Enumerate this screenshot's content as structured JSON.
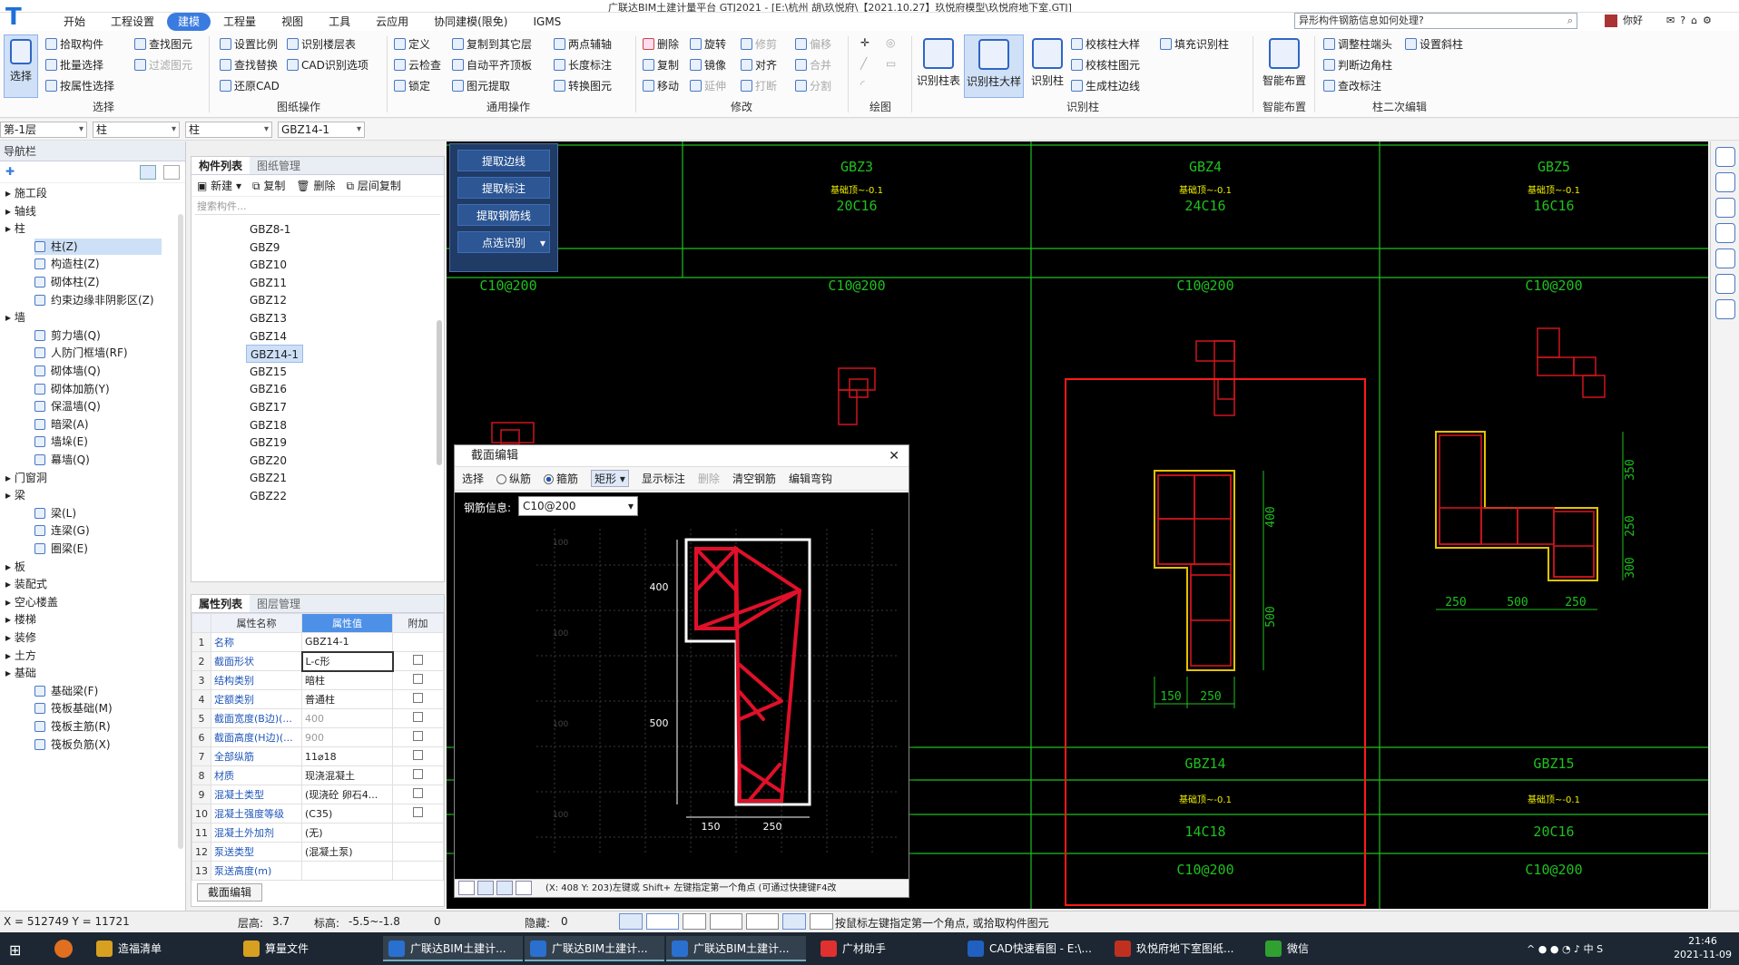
{
  "window": {
    "title": "广联达BIM土建计量平台 GTJ2021 - [E:\\杭州 胡\\玖悦府\\【2021.10.27】玖悦府模型\\玖悦府地下室.GTJ]"
  },
  "menu": {
    "items": [
      "开始",
      "工程设置",
      "建模",
      "工程量",
      "视图",
      "工具",
      "云应用",
      "协同建模(限免)",
      "IGMS"
    ],
    "active": "建模"
  },
  "search": {
    "value": "异形构件钢筋信息如何处理?"
  },
  "user": {
    "greeting": "你好"
  },
  "ribbon": {
    "select": {
      "label": "选择",
      "big": "选择",
      "items": [
        "拾取构件",
        "批量选择",
        "按属性选择"
      ]
    },
    "drawing": {
      "label": "图纸操作",
      "items": [
        "查找图元",
        "过滤图元",
        "设置比例",
        "查找替换",
        "还原CAD",
        "识别楼层表",
        "CAD识别选项"
      ]
    },
    "common": {
      "label": "通用操作",
      "items": [
        "定义",
        "云检查",
        "锁定",
        "复制到其它层",
        "自动平齐顶板",
        "图元提取",
        "两点辅轴",
        "长度标注",
        "转换图元"
      ]
    },
    "modify": {
      "label": "修改",
      "items": [
        "删除",
        "复制",
        "移动",
        "旋转",
        "镜像",
        "延伸",
        "修剪",
        "对齐",
        "打断",
        "偏移",
        "合并",
        "分割"
      ]
    },
    "draw": {
      "label": "绘图"
    },
    "recog": {
      "label": "识别柱",
      "items": [
        "识别柱表",
        "识别柱大样",
        "识别柱",
        "校核柱大样",
        "校核柱图元",
        "生成柱边线",
        "填充识别柱"
      ]
    },
    "smart": {
      "label": "智能布置",
      "big": "智能布置"
    },
    "edit2": {
      "label": "柱二次编辑",
      "items": [
        "调整柱端头",
        "设置斜柱",
        "判断边角柱",
        "查改标注"
      ]
    }
  },
  "selectors": {
    "floor": "第-1层",
    "type": "柱",
    "subtype": "柱",
    "component": "GBZ14-1"
  },
  "nav": {
    "title": "导航栏",
    "tree": [
      {
        "label": "施工段",
        "level": 0
      },
      {
        "label": "轴线",
        "level": 0
      },
      {
        "label": "柱",
        "level": 0
      },
      {
        "label": "柱(Z)",
        "level": 1,
        "selected": true
      },
      {
        "label": "构造柱(Z)",
        "level": 1
      },
      {
        "label": "砌体柱(Z)",
        "level": 1
      },
      {
        "label": "约束边缘非阴影区(Z)",
        "level": 1
      },
      {
        "label": "墙",
        "level": 0
      },
      {
        "label": "剪力墙(Q)",
        "level": 1
      },
      {
        "label": "人防门框墙(RF)",
        "level": 1
      },
      {
        "label": "砌体墙(Q)",
        "level": 1
      },
      {
        "label": "砌体加筋(Y)",
        "level": 1
      },
      {
        "label": "保温墙(Q)",
        "level": 1
      },
      {
        "label": "暗梁(A)",
        "level": 1
      },
      {
        "label": "墙垛(E)",
        "level": 1
      },
      {
        "label": "幕墙(Q)",
        "level": 1
      },
      {
        "label": "门窗洞",
        "level": 0
      },
      {
        "label": "梁",
        "level": 0
      },
      {
        "label": "梁(L)",
        "level": 1
      },
      {
        "label": "连梁(G)",
        "level": 1
      },
      {
        "label": "圈梁(E)",
        "level": 1
      },
      {
        "label": "板",
        "level": 0
      },
      {
        "label": "装配式",
        "level": 0
      },
      {
        "label": "空心楼盖",
        "level": 0
      },
      {
        "label": "楼梯",
        "level": 0
      },
      {
        "label": "装修",
        "level": 0
      },
      {
        "label": "土方",
        "level": 0
      },
      {
        "label": "基础",
        "level": 0
      },
      {
        "label": "基础梁(F)",
        "level": 1
      },
      {
        "label": "筏板基础(M)",
        "level": 1
      },
      {
        "label": "筏板主筋(R)",
        "level": 1
      },
      {
        "label": "筏板负筋(X)",
        "level": 1
      }
    ]
  },
  "complist": {
    "tabs": [
      "构件列表",
      "图纸管理"
    ],
    "tools": [
      "新建",
      "复制",
      "删除",
      "层间复制"
    ],
    "search_placeholder": "搜索构件...",
    "items": [
      "GBZ8-1",
      "GBZ9",
      "GBZ10",
      "GBZ11",
      "GBZ12",
      "GBZ13",
      "GBZ14",
      "GBZ14-1",
      "GBZ15",
      "GBZ16",
      "GBZ17",
      "GBZ18",
      "GBZ19",
      "GBZ20",
      "GBZ21",
      "GBZ22"
    ],
    "selected": "GBZ14-1"
  },
  "props": {
    "tabs": [
      "属性列表",
      "图层管理"
    ],
    "headers": [
      "属性名称",
      "属性值",
      "附加"
    ],
    "rows": [
      {
        "n": "1",
        "k": "名称",
        "v": "GBZ14-1"
      },
      {
        "n": "2",
        "k": "截面形状",
        "v": "L-c形"
      },
      {
        "n": "3",
        "k": "结构类别",
        "v": "暗柱"
      },
      {
        "n": "4",
        "k": "定额类别",
        "v": "普通柱"
      },
      {
        "n": "5",
        "k": "截面宽度(B边)(...",
        "v": "400"
      },
      {
        "n": "6",
        "k": "截面高度(H边)(...",
        "v": "900"
      },
      {
        "n": "7",
        "k": "全部纵筋",
        "v": "11⌀18"
      },
      {
        "n": "8",
        "k": "材质",
        "v": "现浇混凝土"
      },
      {
        "n": "9",
        "k": "混凝土类型",
        "v": "(现浇砼 卵石4..."
      },
      {
        "n": "10",
        "k": "混凝土强度等级",
        "v": "(C35)"
      },
      {
        "n": "11",
        "k": "混凝土外加剂",
        "v": "(无)"
      },
      {
        "n": "12",
        "k": "泵送类型",
        "v": "(混凝土泵)"
      },
      {
        "n": "13",
        "k": "泵送高度(m)",
        "v": ""
      }
    ],
    "button": "截面编辑"
  },
  "floatmenu": [
    "提取边线",
    "提取标注",
    "提取钢筋线",
    "点选识别"
  ],
  "dialog": {
    "title": "截面编辑",
    "tools": [
      "选择",
      "纵筋",
      "箍筋",
      "矩形",
      "显示标注",
      "删除",
      "清空钢筋",
      "编辑弯钩"
    ],
    "rebar_label": "钢筋信息:",
    "rebar_value": "C10@200",
    "dims": {
      "top": "400",
      "mid": "500",
      "b1": "150",
      "b2": "250"
    },
    "grid": "100",
    "status": "(X: 408 Y: 203)左键或 Shift+ 左键指定第一个角点 (可通过快捷键F4改"
  },
  "cad": {
    "top_cols": [
      {
        "name": "GBZ3",
        "elev": "基础顶~-0.1",
        "main": "20C16",
        "stirrup": "C10@200"
      },
      {
        "name": "GBZ4",
        "elev": "基础顶~-0.1",
        "main": "24C16",
        "stirrup": "C10@200"
      },
      {
        "name": "GBZ5",
        "elev": "基础顶~-0.1",
        "main": "16C16",
        "stirrup": "C10@200"
      }
    ],
    "left_stirrup": "C10@200",
    "bottom_cols": [
      {
        "name": "GBZ14",
        "elev": "基础顶~-0.1",
        "main": "14C18",
        "stirrup": "C10@200"
      },
      {
        "name": "GBZ15",
        "elev": "基础顶~-0.1",
        "main": "20C16",
        "stirrup": "C10@200"
      }
    ],
    "dims_mid": {
      "a": "400",
      "b": "500",
      "c": "150",
      "d": "250"
    },
    "dims_right": {
      "a": "350",
      "b": "250",
      "c": "300",
      "d": "250",
      "e": "500",
      "f": "250"
    }
  },
  "status": {
    "coords": "X = 512749 Y = 11721",
    "floor_label": "层高:",
    "floor": "3.7",
    "elev_label": "标高:",
    "elev": "-5.5~-1.8",
    "sel": "0",
    "hidden_label": "隐藏:",
    "hidden": "0",
    "hint": "按鼠标左键指定第一个角点, 或拾取构件图元"
  },
  "taskbar": {
    "items": [
      "造福清单",
      "算量文件",
      "广联达BIM土建计...",
      "广联达BIM土建计...",
      "广联达BIM土建计...",
      "广材助手",
      "CAD快速看图 - E:\\...",
      "玖悦府地下室图纸...",
      "微信"
    ],
    "time": "21:46",
    "date": "2021-11-09",
    "ime": "中"
  }
}
